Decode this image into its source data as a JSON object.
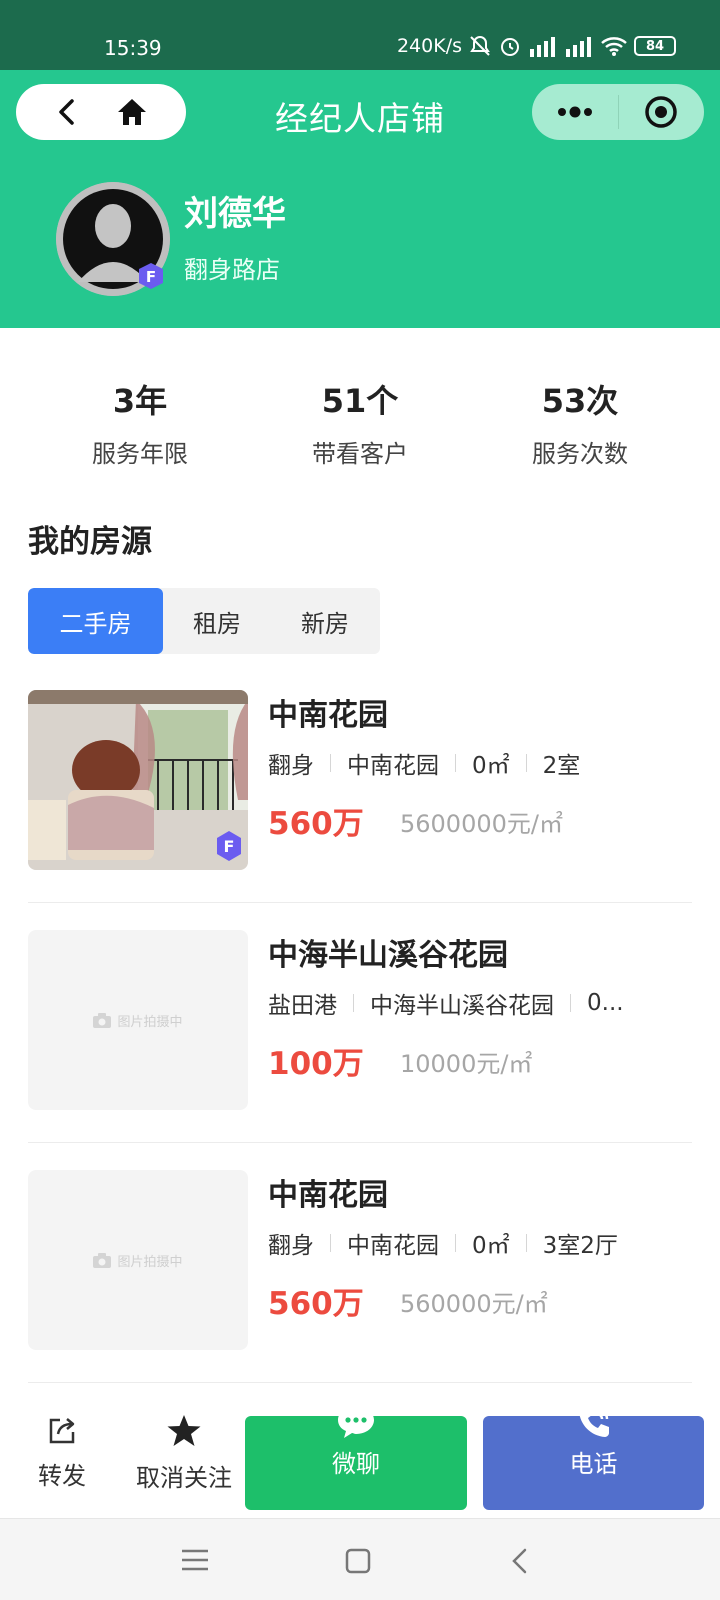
{
  "status_bar": {
    "time": "15:39",
    "speed": "240K/s",
    "battery": "84"
  },
  "header": {
    "title": "经纪人店铺"
  },
  "agent": {
    "name": "刘德华",
    "store": "翻身路店"
  },
  "stats": [
    {
      "value": "3年",
      "label": "服务年限"
    },
    {
      "value": "51个",
      "label": "带看客户"
    },
    {
      "value": "53次",
      "label": "服务次数"
    }
  ],
  "section": {
    "title": "我的房源"
  },
  "tabs": [
    {
      "label": "二手房",
      "active": true
    },
    {
      "label": "租房",
      "active": false
    },
    {
      "label": "新房",
      "active": false
    }
  ],
  "listings": [
    {
      "title": "中南花园",
      "district": "翻身",
      "community": "中南花园",
      "area": "0㎡",
      "layout": "2室",
      "price": "560万",
      "unit_price": "5600000元/㎡",
      "has_photo": true
    },
    {
      "title": "中海半山溪谷花园",
      "district": "盐田港",
      "community": "中海半山溪谷花园",
      "area": "0...",
      "layout": "",
      "price": "100万",
      "unit_price": "10000元/㎡",
      "has_photo": false,
      "placeholder": "图片拍摄中"
    },
    {
      "title": "中南花园",
      "district": "翻身",
      "community": "中南花园",
      "area": "0㎡",
      "layout": "3室2厅",
      "price": "560万",
      "unit_price": "560000元/㎡",
      "has_photo": false,
      "placeholder": "图片拍摄中"
    }
  ],
  "actions": {
    "share": "转发",
    "unfollow": "取消关注",
    "chat": "微聊",
    "phone": "电话"
  },
  "colors": {
    "header_green": "#25c78f",
    "status_green": "#1c6b4d",
    "tab_blue": "#3b7ef6",
    "price_red": "#ec4b3f",
    "chat_green": "#1dbf6a",
    "phone_blue": "#526fcc"
  },
  "icons": [
    "back-icon",
    "home-icon",
    "more-icon",
    "target-icon",
    "share-icon",
    "star-icon",
    "chat-bubble-icon",
    "phone-icon",
    "camera-icon",
    "menu-icon",
    "square-icon",
    "nav-back-icon"
  ]
}
